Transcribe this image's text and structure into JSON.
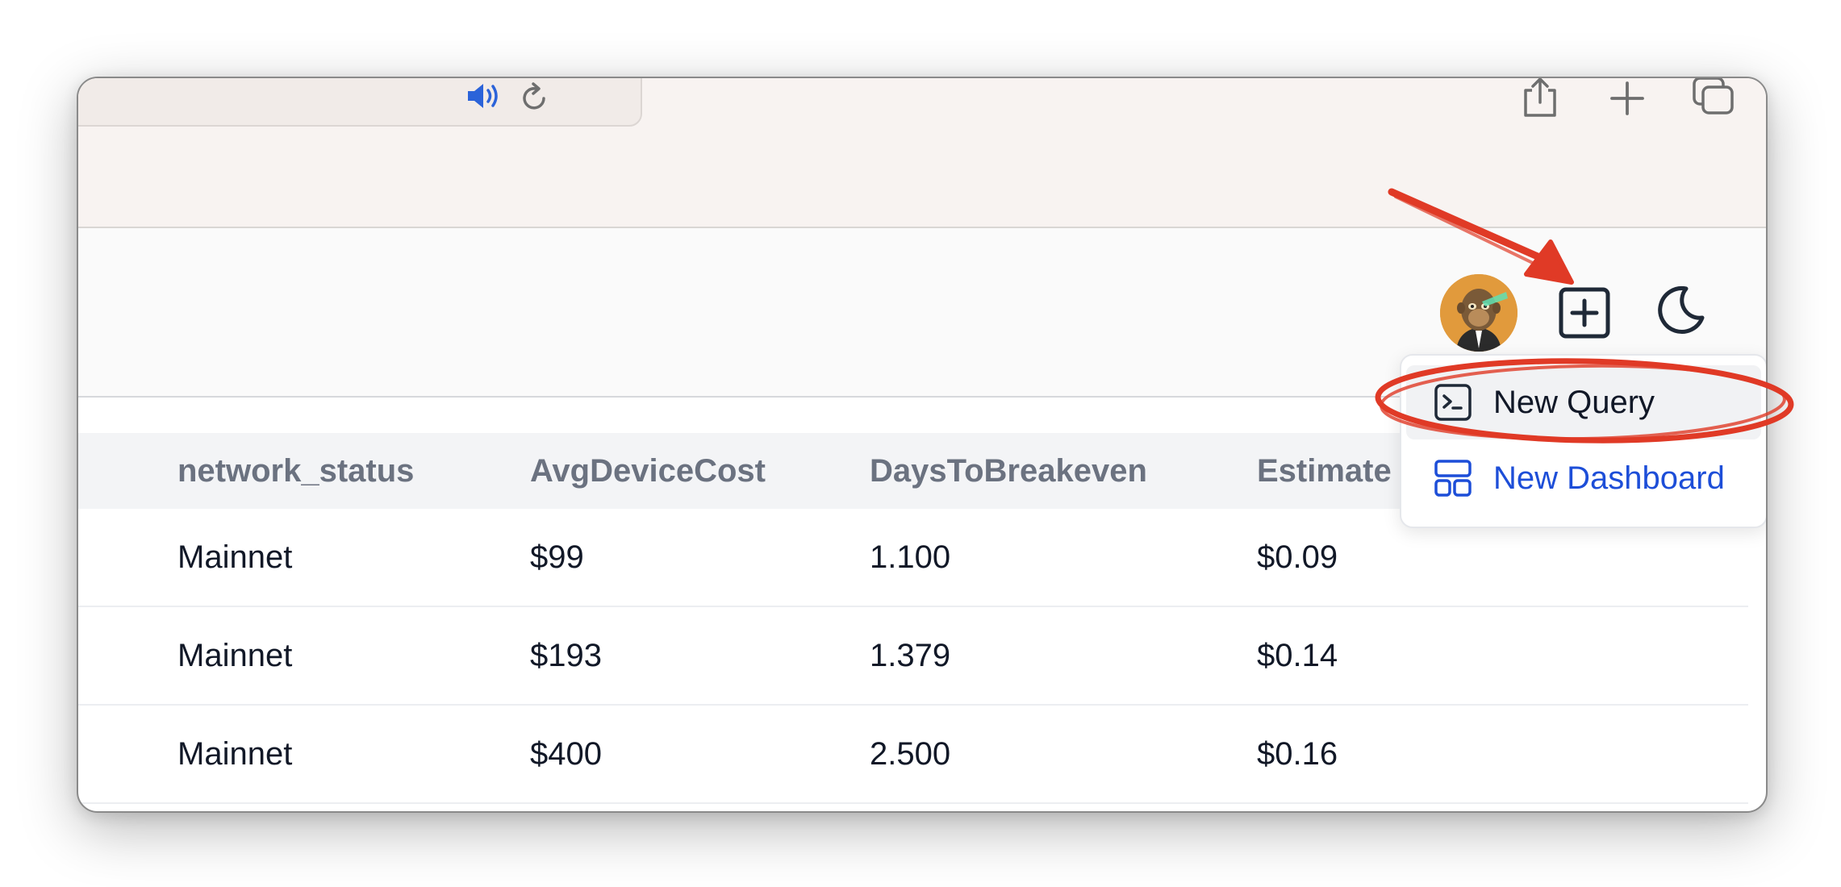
{
  "browser": {
    "icons": [
      "speaker-icon",
      "reload-icon",
      "share-icon",
      "new-tab-icon",
      "tabs-overview-icon"
    ]
  },
  "header": {
    "avatar": "ape-avatar",
    "actions": [
      "new-item-plus-icon",
      "moon-icon"
    ]
  },
  "menu": {
    "new_query": "New Query",
    "new_dashboard": "New Dashboard",
    "accent_color": "#1d4ed8"
  },
  "table": {
    "columns": [
      "network_status",
      "AvgDeviceCost",
      "DaysToBreakeven",
      "Estimate"
    ],
    "rows": [
      [
        "Mainnet",
        "$99",
        "1.100",
        "$0.09"
      ],
      [
        "Mainnet",
        "$193",
        "1.379",
        "$0.14"
      ],
      [
        "Mainnet",
        "$400",
        "2.500",
        "$0.16"
      ]
    ]
  },
  "annotation": {
    "color": "#e03a26"
  }
}
